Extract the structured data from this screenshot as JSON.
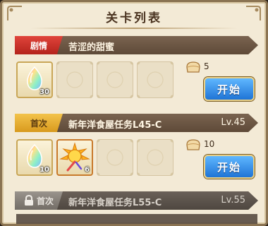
{
  "title": "关卡列表",
  "stages": [
    {
      "tag": "剧情",
      "name": "苦涩的甜蜜",
      "level": "",
      "items": [
        {
          "icon": "rainbow-crystal-icon",
          "qty": "30"
        }
      ],
      "cost": "5",
      "button": "开始"
    },
    {
      "tag": "首次",
      "name": "新年洋食屋任务L45-C",
      "level": "Lv.45",
      "items": [
        {
          "icon": "rainbow-crystal-icon",
          "qty": "10"
        },
        {
          "icon": "sun-feather-icon",
          "qty": "6"
        }
      ],
      "cost": "10",
      "button": "开始"
    },
    {
      "tag": "首次",
      "name": "新年洋食屋任务L55-C",
      "level": "Lv.55",
      "locked": true
    }
  ],
  "colors": {
    "panel": "#f3ead6",
    "story_tag": "#d0342c",
    "first_tag": "#e6ae30",
    "start_button": "#2f8ae8"
  }
}
